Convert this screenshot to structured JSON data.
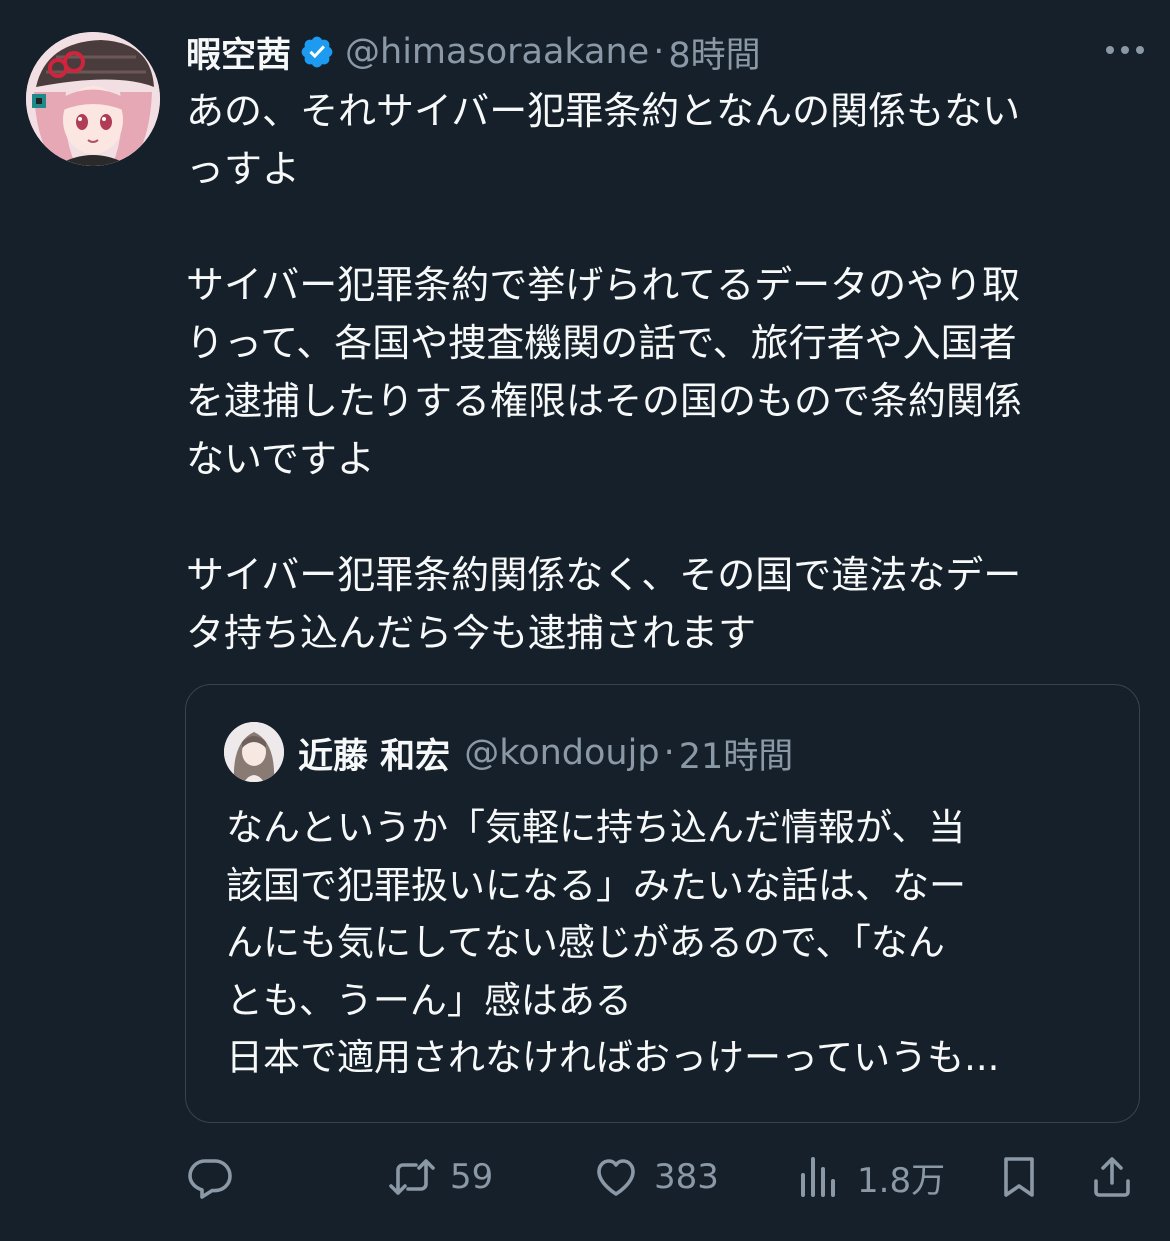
{
  "tweet": {
    "display_name": "暇空茜",
    "handle": "@himasoraakane",
    "separator": "·",
    "time": "8時間",
    "text": "あの、それサイバー犯罪条約となんの関係もない\nっすよ\n\nサイバー犯罪条約で挙げられてるデータのやり取\nりって、各国や捜査機関の話で、旅行者や入国者\nを逮捕したりする権限はその国のもので条約関係\nないですよ\n\nサイバー犯罪条約関係なく、その国で違法なデー\nタ持ち込んだら今も逮捕されます"
  },
  "quote": {
    "display_name": "近藤 和宏",
    "handle": "@kondoujp",
    "separator": "·",
    "time": "21時間",
    "text": "なんというか「気軽に持ち込んだ情報が、当\n該国で犯罪扱いになる」みたいな話は、なー\nんにも気にしてない感じがあるので、「なん\nとも、うーん」感はある\n日本で適用されなければおっけーっていうも..."
  },
  "actions": {
    "reply_icon": "reply-icon",
    "retweet_icon": "retweet-icon",
    "retweet_count": "59",
    "like_icon": "heart-icon",
    "like_count": "383",
    "views_icon": "bar-chart-icon",
    "views_count": "1.8万",
    "bookmark_icon": "bookmark-icon",
    "share_icon": "share-icon"
  },
  "colors": {
    "background": "#15202b",
    "text_primary": "#f7f9f9",
    "text_secondary": "#8b98a5",
    "border": "#38444d",
    "verified_badge": "#1d9bf0"
  }
}
